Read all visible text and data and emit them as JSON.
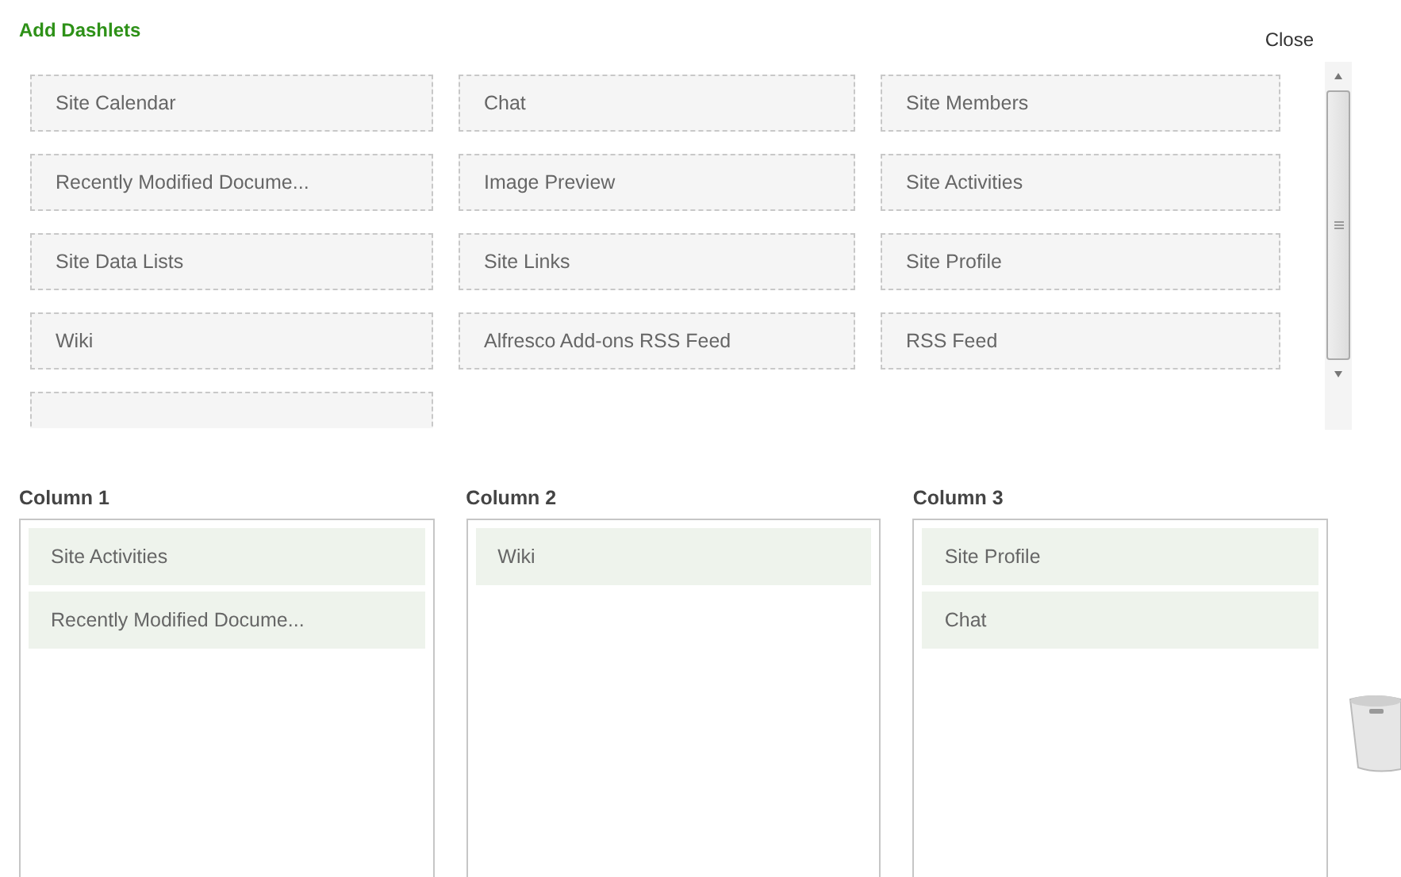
{
  "title": "Add Dashlets",
  "close": "Close",
  "dashlets": [
    {
      "label": "Site Calendar"
    },
    {
      "label": "Chat"
    },
    {
      "label": "Site Members"
    },
    {
      "label": "Recently Modified Docume..."
    },
    {
      "label": "Image Preview"
    },
    {
      "label": "Site Activities"
    },
    {
      "label": "Site Data Lists"
    },
    {
      "label": "Site Links"
    },
    {
      "label": "Site Profile"
    },
    {
      "label": "Wiki"
    },
    {
      "label": "Alfresco Add-ons RSS Feed"
    },
    {
      "label": "RSS Feed"
    }
  ],
  "columns": [
    {
      "title": "Column 1",
      "items": [
        "Site Activities",
        "Recently Modified Docume..."
      ]
    },
    {
      "title": "Column 2",
      "items": [
        "Wiki"
      ]
    },
    {
      "title": "Column 3",
      "items": [
        "Site Profile",
        "Chat"
      ]
    }
  ]
}
